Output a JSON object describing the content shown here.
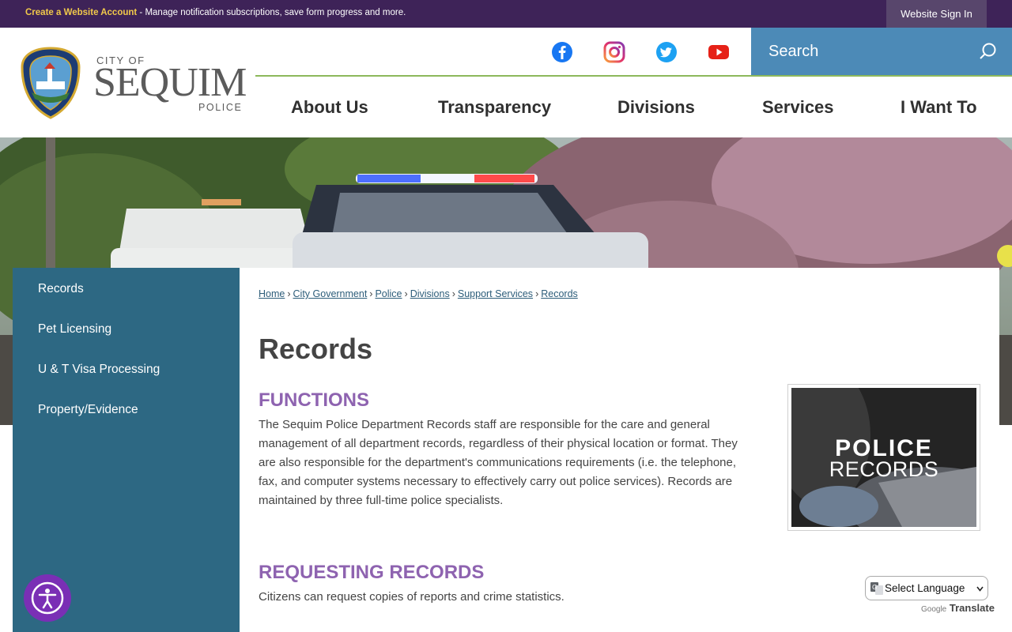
{
  "topbar": {
    "create_link": "Create a Website Account",
    "message": " - Manage notification subscriptions, save form progress and more.",
    "sign_in": "Website Sign In"
  },
  "logo": {
    "city_of": "CITY OF",
    "name": "SEQUIM",
    "police": "POLICE",
    "badge_top": "POLICE",
    "badge_bottom": "SEQUIM"
  },
  "social": [
    "facebook-icon",
    "instagram-icon",
    "twitter-icon",
    "youtube-icon"
  ],
  "search": {
    "placeholder": "Search"
  },
  "nav": {
    "about": "About Us",
    "transparency": "Transparency",
    "divisions": "Divisions",
    "services": "Services",
    "iwantto": "I Want To"
  },
  "sidebar": {
    "items": [
      "Records",
      "Pet Licensing",
      "U & T Visa Processing",
      "Property/Evidence"
    ]
  },
  "breadcrumb": [
    "Home",
    "City Government",
    "Police",
    "Divisions",
    "Support Services",
    "Records"
  ],
  "page": {
    "title": "Records",
    "functions_heading": "FUNCTIONS",
    "functions_text": "The Sequim Police Department Records staff are responsible for the care and general management of all department records, regardless of their physical location or format. They are also responsible for the department's communications requirements (i.e. the telephone, fax, and computer systems necessary to effectively carry out police services). Records are maintained by three full-time police specialists.",
    "requesting_heading": "REQUESTING RECORDS",
    "requesting_text": "Citizens can request copies of reports and crime statistics.",
    "image_line1": "POLICE",
    "image_line2": "RECORDS"
  },
  "translate": {
    "select_label": "Select Language",
    "google": "Google",
    "translate": "Translate"
  },
  "colors": {
    "topbar": "#3e2358",
    "sidebar": "#2d6883",
    "search": "#4c8ab7",
    "heading_purple": "#8e63b0",
    "nav_underline": "#8cb85b"
  }
}
